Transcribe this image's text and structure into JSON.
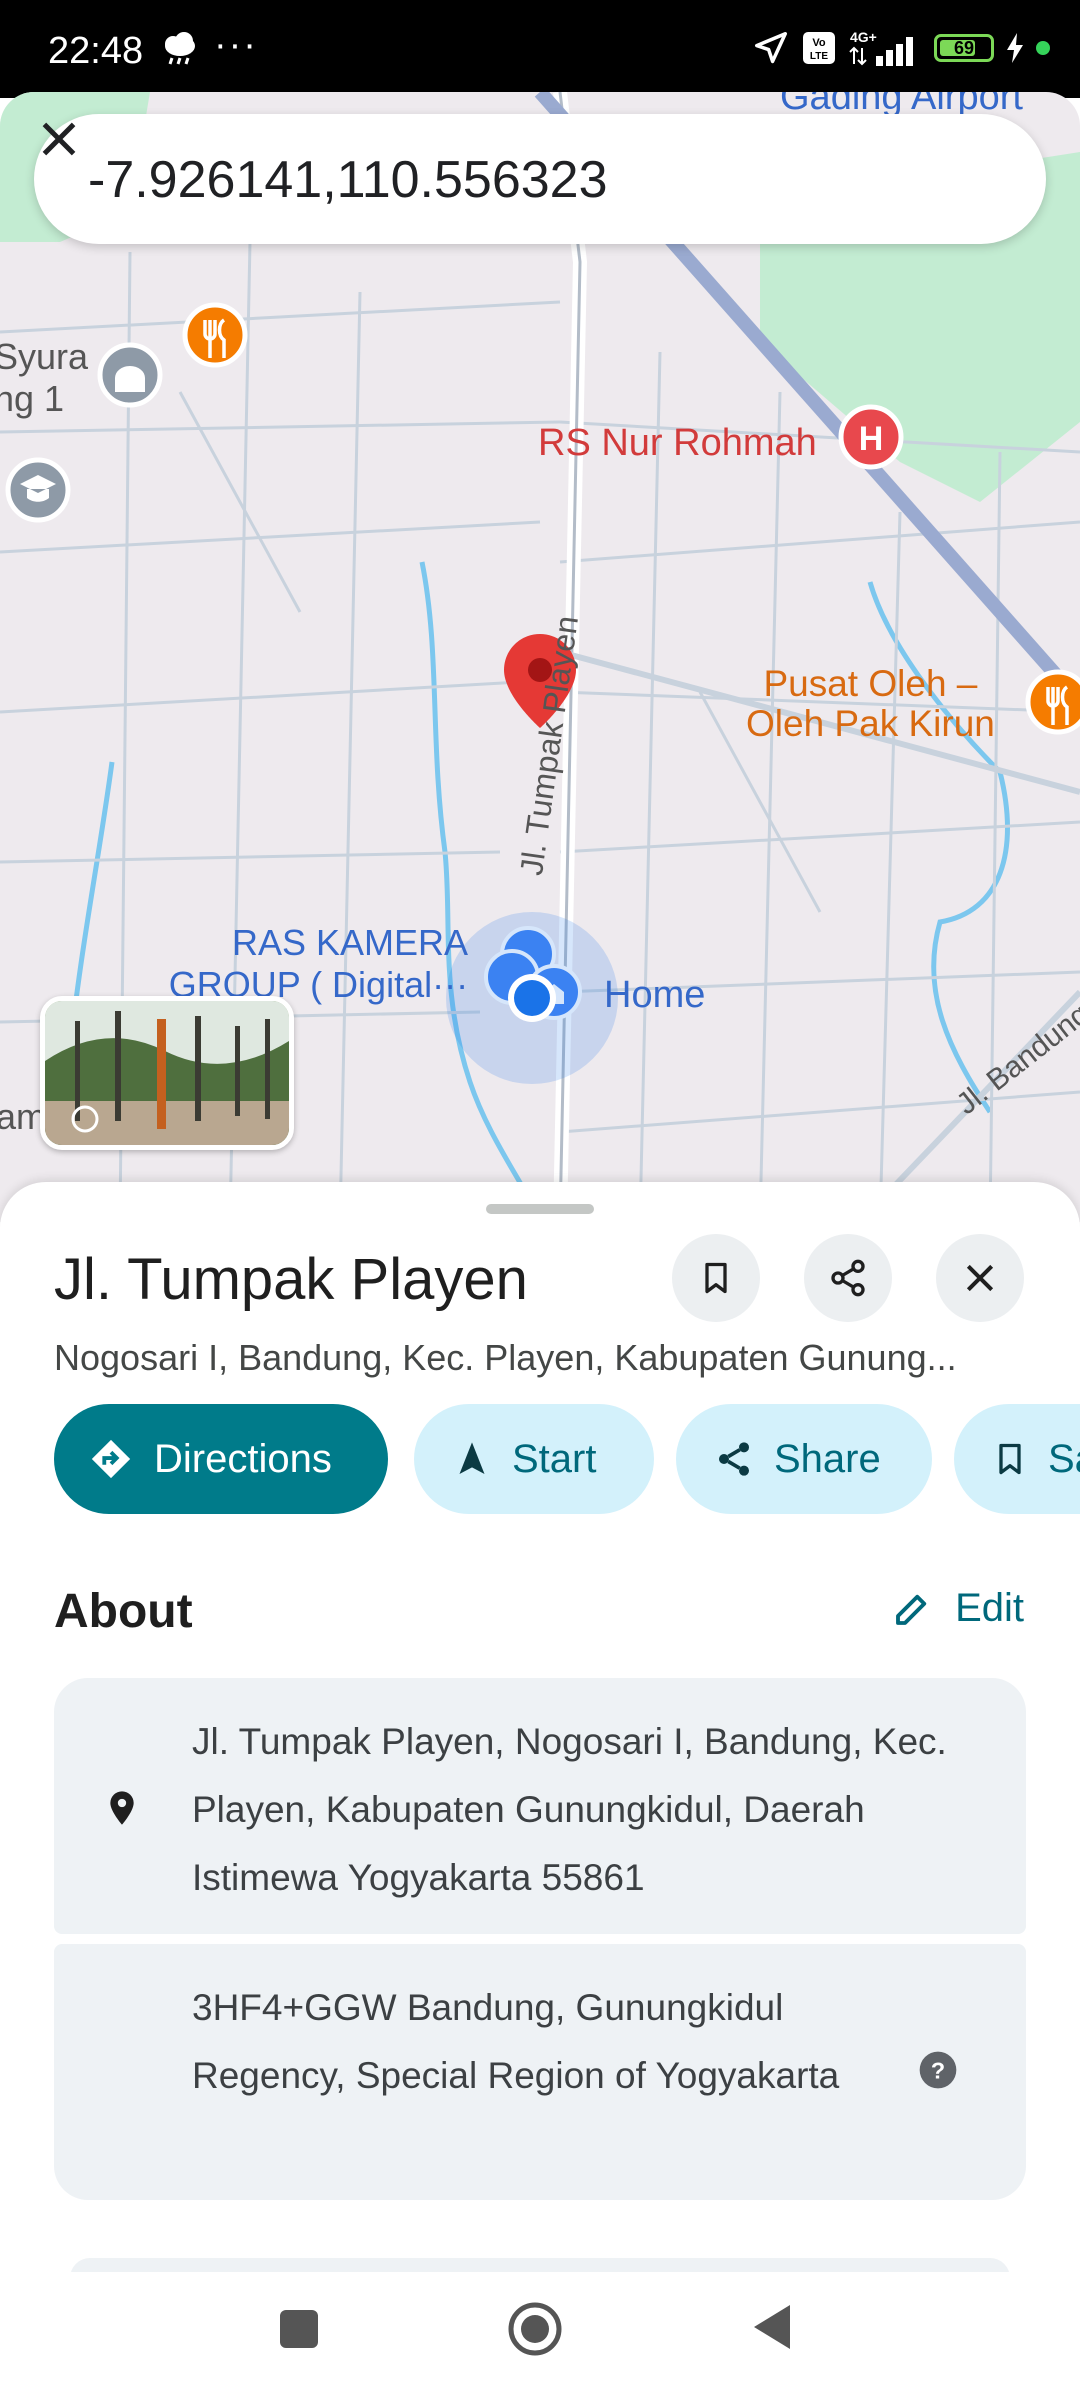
{
  "status_bar": {
    "time": "22:48",
    "dots": "···",
    "battery": "69",
    "icons": [
      "cloud-rain-icon",
      "location-arrow-icon",
      "volte-icon",
      "signal-4g-icon",
      "battery-icon",
      "charging-bolt-icon"
    ]
  },
  "search": {
    "query": "-7.926141,110.556323"
  },
  "map": {
    "labels": {
      "airport": "Gading Airport",
      "rs": "RS Nur Rohmah",
      "pusat_line1": "Pusat Oleh –",
      "pusat_line2": "Oleh Pak Kirun",
      "ras_line1": "RAS KAMERA",
      "ras_line2": "GROUP ( Digital···",
      "home": "Home",
      "road_tumpak": "Jl. Tumpak Playen",
      "road_bandung": "Jl. Bandung",
      "syura_line1": "Syura",
      "syura_line2": "ng 1",
      "left_am": "am"
    },
    "colors": {
      "pin": "#e53935",
      "hospital": "#e8484d",
      "food": "#f57c00",
      "user_location": "#1a73e8",
      "park": "#c3ecd2"
    }
  },
  "place": {
    "title": "Jl. Tumpak Playen",
    "subtitle": "Nogosari I, Bandung, Kec. Playen, Kabupaten Gunung..."
  },
  "actions": {
    "directions": "Directions",
    "start": "Start",
    "share": "Share",
    "save": "Save"
  },
  "about": {
    "title": "About",
    "edit": "Edit",
    "address": "Jl. Tumpak Playen, Nogosari I, Bandung, Kec. Playen, Kabupaten Gunungkidul, Daerah Istimewa Yogyakarta 55861",
    "plus_code": "3HF4+GGW Bandung, Gunungkidul Regency, Special Region of Yogyakarta"
  },
  "theme": {
    "primary": "#007b8a",
    "chip_bg": "#d3f1fb"
  }
}
